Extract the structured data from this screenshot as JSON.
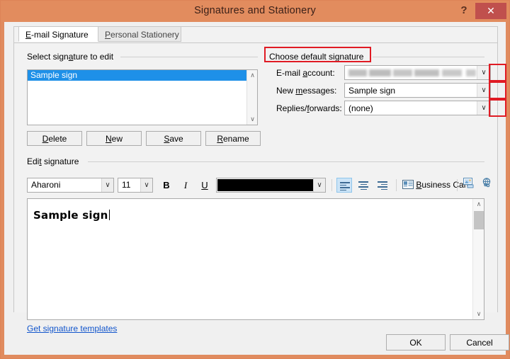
{
  "window": {
    "title": "Signatures and Stationery",
    "help_label": "?",
    "close_label": "✕",
    "titlebar_color": "#E28C5E",
    "close_button_color": "#C0504D"
  },
  "tabs": [
    {
      "label_pre": "",
      "label_underline": "E",
      "label_post": "-mail Signature",
      "active": true
    },
    {
      "label_pre": "",
      "label_underline": "P",
      "label_post": "ersonal Stationery",
      "active": false
    }
  ],
  "select_signature": {
    "group_label": "Select signature to edit",
    "list_items": [
      "Sample sign"
    ],
    "selected_item": "Sample sign",
    "selection_color": "#1E90E8",
    "scroll_up_icon": "∧",
    "scroll_down_icon": "∨",
    "buttons": [
      {
        "pre": "",
        "underline": "D",
        "post": "elete"
      },
      {
        "pre": "",
        "underline": "N",
        "post": "ew"
      },
      {
        "pre": "",
        "underline": "S",
        "post": "ave"
      },
      {
        "pre": "",
        "underline": "R",
        "post": "ename"
      }
    ]
  },
  "choose_default": {
    "group_label": "Choose default signature",
    "fields": [
      {
        "label_pre": "E-mail ",
        "label_underline": "a",
        "label_post": "ccount:",
        "value": "",
        "redacted": true
      },
      {
        "label_pre": "New ",
        "label_underline": "m",
        "label_post": "essages:",
        "value": "Sample sign",
        "redacted": false
      },
      {
        "label_pre": "Replies/",
        "label_underline": "f",
        "label_post": "orwards:",
        "value": "(none)",
        "redacted": false
      }
    ],
    "dropdown_icon": "∨",
    "annotation_color": "#E01B24"
  },
  "edit_signature": {
    "group_label": "Edit signature",
    "toolbar": {
      "font_name": "Aharoni",
      "font_size": "11",
      "bold_label": "B",
      "italic_label": "I",
      "underline_label": "U",
      "font_color": "#000000",
      "dropdown_icon": "∨",
      "align_left_active": true,
      "business_card_pre": "",
      "business_card_underline": "B",
      "business_card_post": "usiness Card",
      "picture_icon": "insert-picture-icon",
      "hyperlink_icon": "insert-hyperlink-icon"
    },
    "content": "Sample sign"
  },
  "templates_link": "Get signature templates",
  "footer": {
    "ok_label": "OK",
    "cancel_label": "Cancel"
  }
}
